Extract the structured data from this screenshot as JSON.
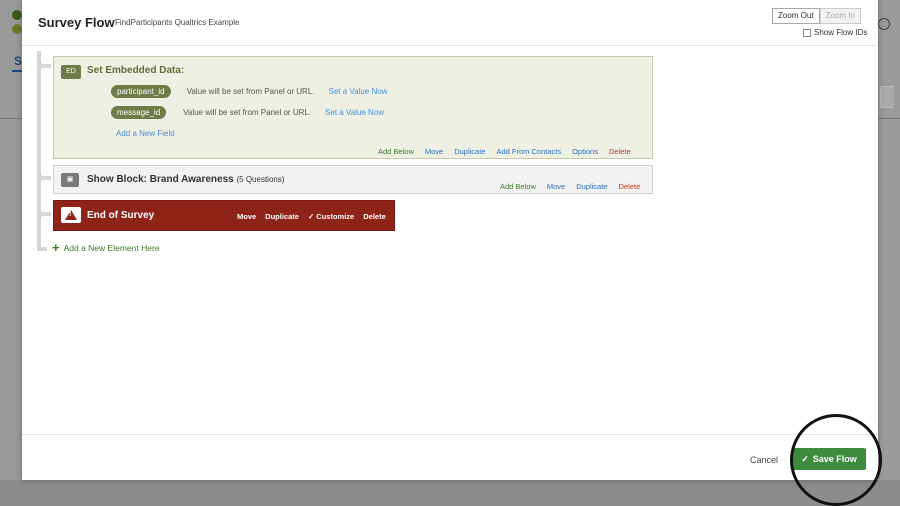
{
  "modal": {
    "title": "Survey Flow",
    "subtitle": "FindParticipants Qualtrics Example",
    "zoom_out": "Zoom Out",
    "zoom_in": "Zoom In",
    "show_flow_ids": "Show Flow IDs",
    "show_flow_ids_checked": false
  },
  "background": {
    "tab_letter": "S"
  },
  "embedded": {
    "icon": "ED",
    "title": "Set Embedded Data:",
    "fields": [
      {
        "name": "participant_id",
        "desc": "Value will be set from Panel or URL.",
        "link": "Set a Value Now"
      },
      {
        "name": "message_id",
        "desc": "Value will be set from Panel or URL.",
        "link": "Set a Value Now"
      }
    ],
    "add_field": "Add a New Field",
    "actions": {
      "add_below": "Add Below",
      "move": "Move",
      "duplicate": "Duplicate",
      "add_from_contacts": "Add From Contacts",
      "options": "Options",
      "delete": "Delete"
    }
  },
  "block": {
    "title": "Show Block: Brand Awareness",
    "count": "(5 Questions)",
    "actions": {
      "add_below": "Add Below",
      "move": "Move",
      "duplicate": "Duplicate",
      "delete": "Delete"
    }
  },
  "end": {
    "title": "End of Survey",
    "actions": {
      "move": "Move",
      "duplicate": "Duplicate",
      "customize": "✓ Customize",
      "delete": "Delete"
    }
  },
  "add_element": "Add a New Element Here",
  "footer": {
    "cancel": "Cancel",
    "save": "Save Flow"
  },
  "colors": {
    "embedded_bg": "#eef0e3",
    "end_bg": "#8e2318",
    "save_bg": "#3d8b3d",
    "link_blue": "#4a90d9",
    "action_green": "#3c7a28",
    "action_red": "#c4391d"
  }
}
